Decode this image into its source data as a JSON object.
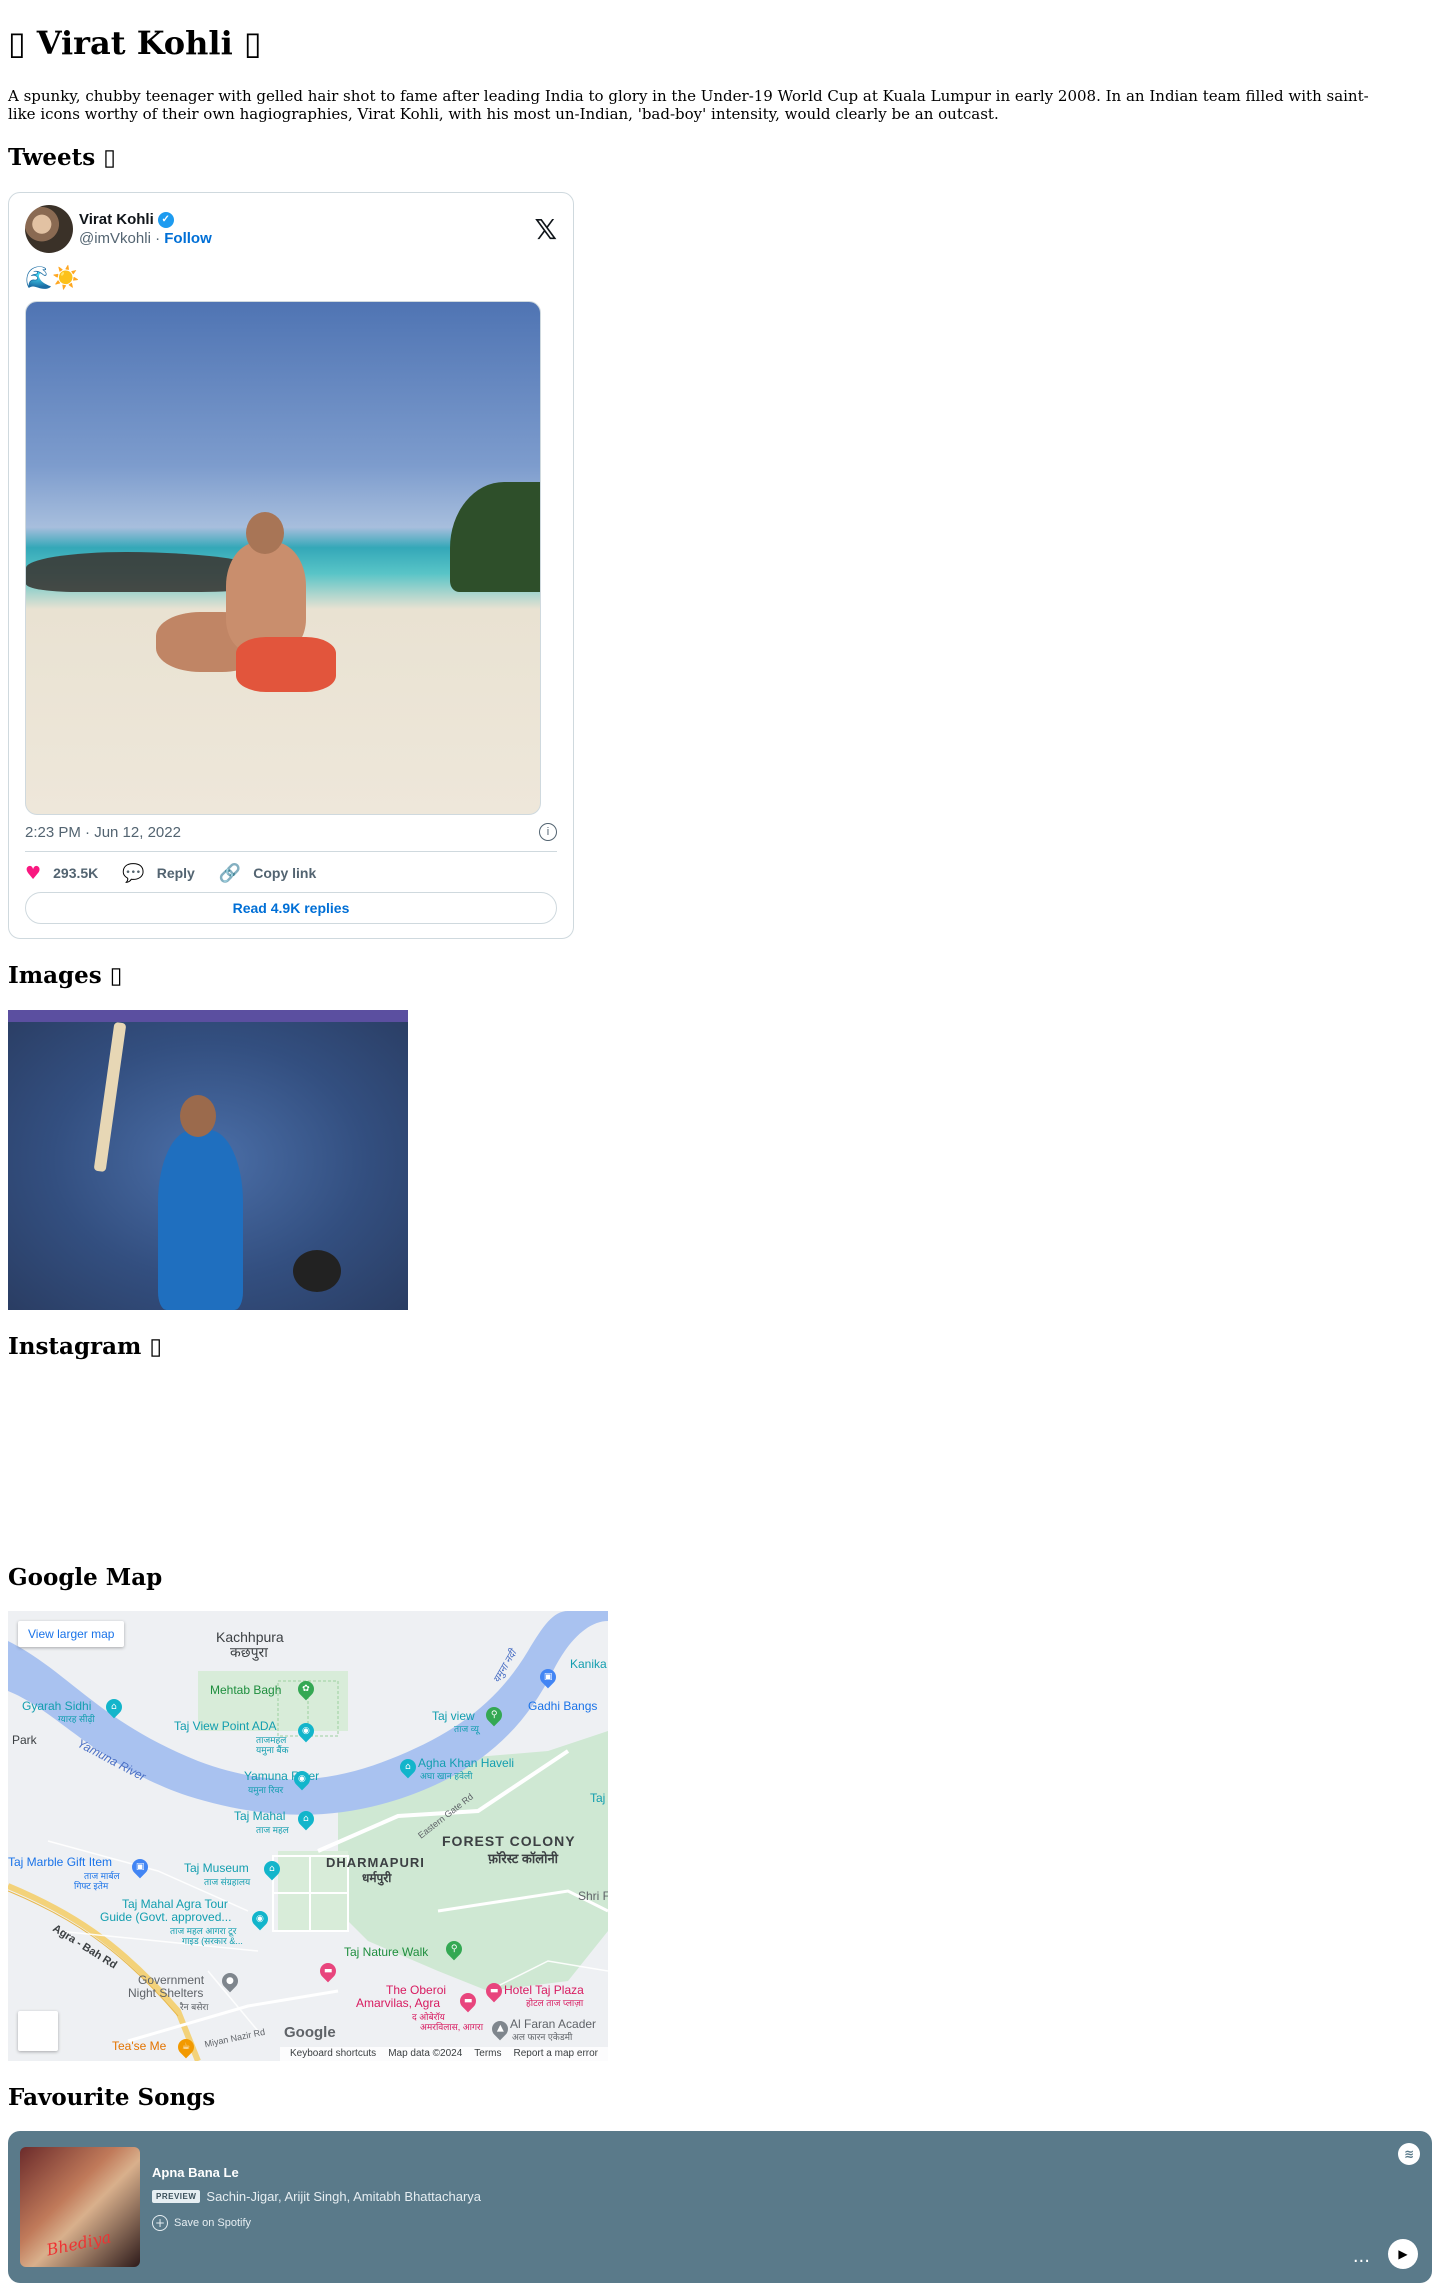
{
  "page": {
    "title": "Virat Kohli",
    "title_icon": "flag-icon",
    "intro": "A spunky, chubby teenager with gelled hair shot to fame after leading India to glory in the Under-19 World Cup at Kuala Lumpur in early 2008. In an Indian team filled with saint-like icons worthy of their own hagiographies, Virat Kohli, with his most un-Indian, 'bad-boy' intensity, would clearly be an outcast."
  },
  "sections": {
    "tweets": "Tweets",
    "images": "Images",
    "instagram": "Instagram",
    "map": "Google Map",
    "songs": "Favourite Songs"
  },
  "tweet": {
    "name": "Virat Kohli",
    "handle": "@imVkohli",
    "separator": " · ",
    "follow": "Follow",
    "text": "🌊☀️",
    "timestamp": "2:23 PM · Jun 12, 2022",
    "likes": "293.5K",
    "reply": "Reply",
    "copy_link": "Copy link",
    "read_replies": "Read 4.9K replies",
    "colors": {
      "like": "#f91880",
      "link": "#006fd6",
      "verified": "#1d9bf0"
    }
  },
  "map": {
    "view_larger": "View larger map",
    "labels": {
      "kachhpura": "Kachhpura",
      "kachhpura_hi": "कछपुरा",
      "mehtab_bagh": "Mehtab Bagh",
      "gyarah_sidhi": "Gyarah Sidhi",
      "gyarah_sidhi_hi": "ग्यारह सीढ़ी",
      "park": "Park",
      "yamuna_river_water": "Yamuna River",
      "yamuna_hi": "यमुना नदी",
      "taj_view_point": "Taj View Point ADA",
      "taj_view_point_hi1": "ताजमहल",
      "taj_view_point_hi2": "यमुना बैंक",
      "yamuna_river_poi": "Yamuna River",
      "yamuna_river_poi_hi": "यमुना रिवर",
      "taj_view": "Taj view",
      "taj_view_hi": "ताज व्यू",
      "gadhi_bangs": "Gadhi Bangs",
      "kanika": "Kanika",
      "agha_khan": "Agha Khan Haveli",
      "agha_khan_hi": "अघा खान हवेली",
      "taj_mahal": "Taj Mahal",
      "taj_mahal_hi": "ताज महल",
      "taj_right": "Taj",
      "forest_colony": "FOREST COLONY",
      "forest_colony_hi": "फ़ॉरेस्ट कॉलोनी",
      "dharmapuri": "DHARMAPURI",
      "dharmapuri_hi": "धर्मपुरी",
      "eastern_gate_rd": "Eastern Gate Rd",
      "taj_marble": "Taj Marble Gift Item",
      "taj_marble_hi1": "ताज मार्बल",
      "taj_marble_hi2": "गिफ्ट इतेम",
      "taj_museum": "Taj Museum",
      "taj_museum_hi": "ताज संग्रहालय",
      "shri": "Shri F",
      "taj_tour": "Taj Mahal Agra Tour",
      "taj_tour_2": "Guide (Govt. approved...",
      "taj_tour_hi1": "ताज महल आगरा टूर",
      "taj_tour_hi2": "गाइड (सरकार &...",
      "taj_nature_walk": "Taj Nature Walk",
      "agra_bah_rd": "Agra - Bah Rd",
      "govt_shelters": "Government",
      "govt_shelters_2": "Night Shelters",
      "govt_shelters_hi": "रैन बसेरा",
      "oberoi": "The Oberoi",
      "oberoi_2": "Amarvilas, Agra",
      "oberoi_hi1": "द ओबेरॉय",
      "oberoi_hi2": "अमरविलास, आगरा",
      "hotel_taj_plaza": "Hotel Taj Plaza",
      "hotel_taj_plaza_hi": "होटल ताज प्लाज़ा",
      "al_faran": "Al Faran Acader",
      "al_faran_hi": "अल फारन एकेडमी",
      "tease_me": "Tea'se Me",
      "miyan_nazir": "Miyan Nazir Rd"
    },
    "google": "Google",
    "footer": {
      "shortcuts": "Keyboard shortcuts",
      "data": "Map data ©2024",
      "terms": "Terms",
      "report": "Report a map error"
    }
  },
  "song": {
    "title": "Apna Bana Le",
    "badge": "PREVIEW",
    "artists": "Sachin-Jigar, Arijit Singh, Amitabh Bhattacharya",
    "save": "Save on Spotify",
    "more": "...",
    "background": "#5a7a8a"
  }
}
